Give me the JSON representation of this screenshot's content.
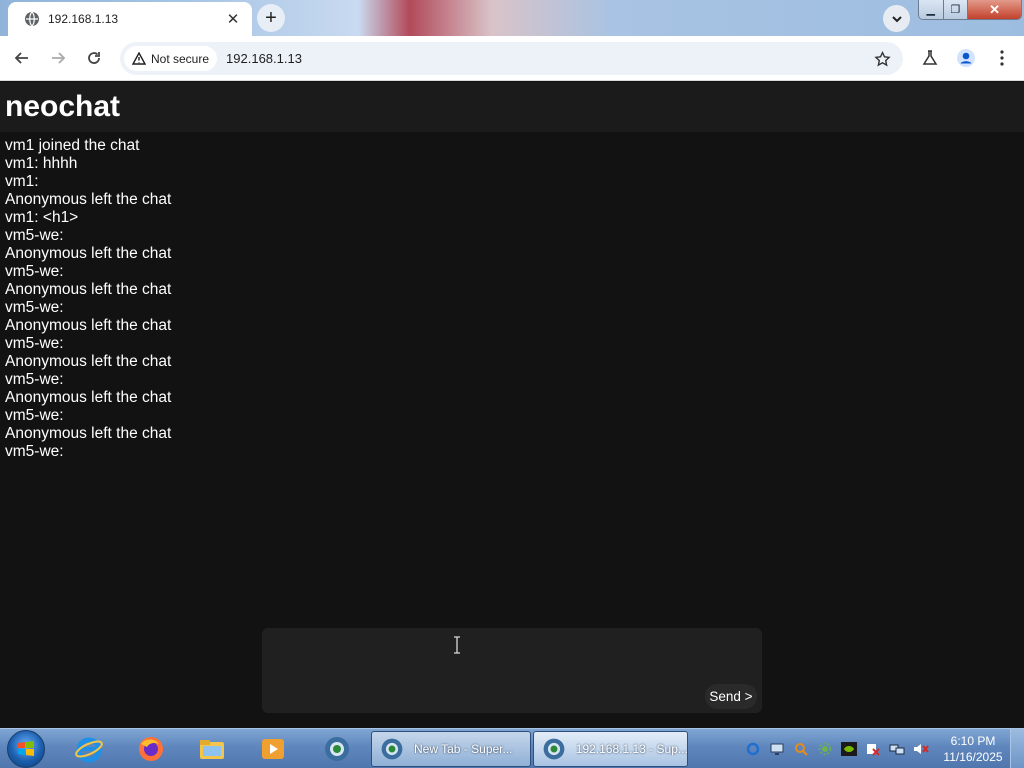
{
  "browser": {
    "tab_title": "192.168.1.13",
    "security_label": "Not secure",
    "url": "192.168.1.13"
  },
  "app": {
    "title": "neochat",
    "messages": [
      "vm1 joined the chat",
      "vm1: hhhh",
      "vm1:",
      "Anonymous left the chat",
      "vm1: <h1>",
      "vm5-we:",
      "Anonymous left the chat",
      "vm5-we:",
      "Anonymous left the chat",
      "vm5-we:",
      "Anonymous left the chat",
      "vm5-we:",
      "Anonymous left the chat",
      "vm5-we:",
      "Anonymous left the chat",
      "vm5-we:",
      "Anonymous left the chat",
      "vm5-we:"
    ],
    "composer_value": "",
    "send_label": "Send >"
  },
  "taskbar": {
    "tasks": [
      {
        "label": "New Tab - Super..."
      },
      {
        "label": "192.168.1.13 - Sup..."
      }
    ],
    "clock_time": "6:10 PM",
    "clock_date": "11/16/2025"
  },
  "colors": {
    "page_bg": "#121212",
    "header_bg": "#1b1b1b",
    "composer_bg": "#202020",
    "text": "#ffffff"
  }
}
